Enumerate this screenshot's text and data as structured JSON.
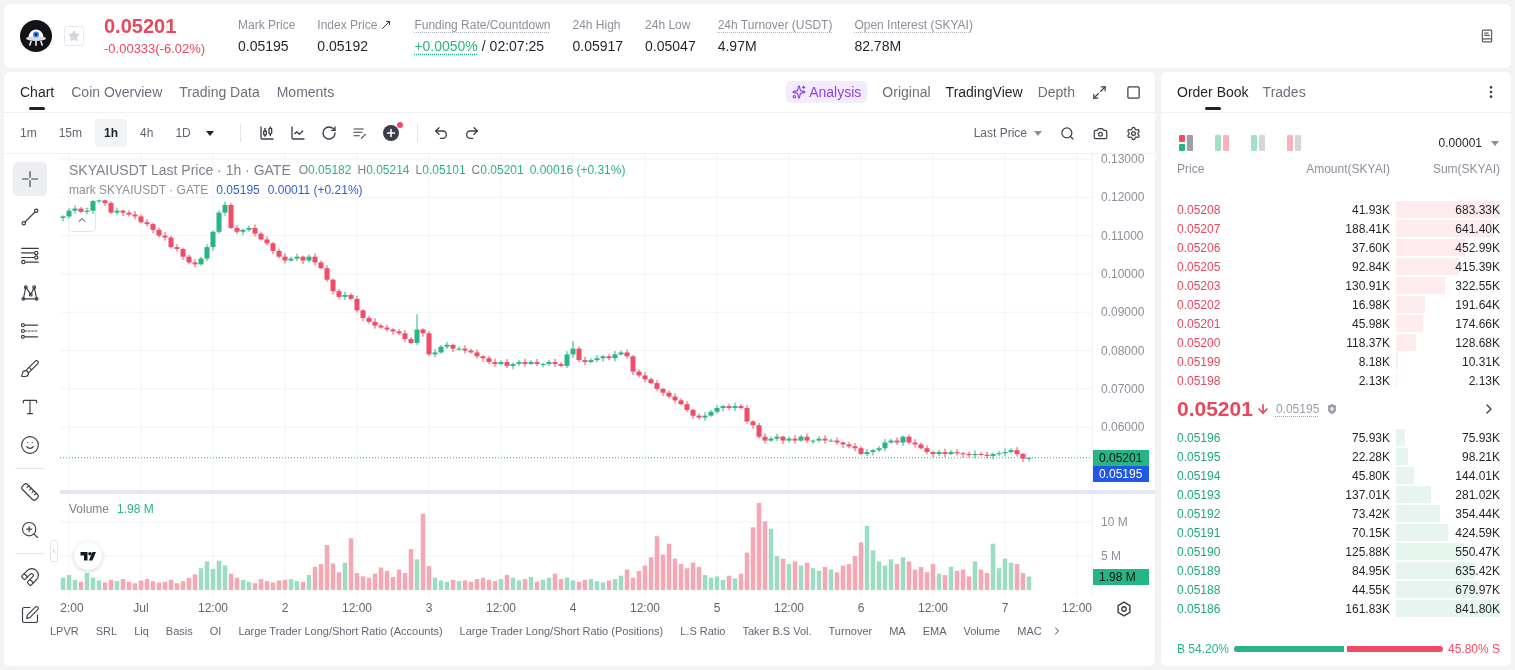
{
  "header": {
    "favorite": false,
    "last_price": "0.05201",
    "change": "-0.00333(-6.02%)",
    "rising": false,
    "stats": [
      {
        "label": "Mark Price",
        "value": "0.05195",
        "kind": "plain",
        "tooltip": false
      },
      {
        "label": "Index Price",
        "value": "0.05192",
        "kind": "link",
        "tooltip": false
      },
      {
        "label": "Funding Rate/Countdown",
        "value": "+0.0050%",
        "countdown": "/ 02:07:25",
        "kind": "funding",
        "tooltip": true
      },
      {
        "label": "24h High",
        "value": "0.05917",
        "kind": "plain",
        "tooltip": false
      },
      {
        "label": "24h Low",
        "value": "0.05047",
        "kind": "plain",
        "tooltip": false
      },
      {
        "label": "24h Turnover (USDT)",
        "value": "4.97M",
        "kind": "plain",
        "tooltip": true
      },
      {
        "label": "Open Interest (SKYAI)",
        "value": "82.78M",
        "kind": "plain",
        "tooltip": true
      }
    ]
  },
  "chart_panel": {
    "tabs": [
      {
        "label": "Chart",
        "selected": true
      },
      {
        "label": "Coin Overview",
        "selected": false
      },
      {
        "label": "Trading Data",
        "selected": false
      },
      {
        "label": "Moments",
        "selected": false
      }
    ],
    "views": [
      {
        "label": "Analysis",
        "kind": "ai",
        "selected": false
      },
      {
        "label": "Original",
        "kind": "plain",
        "selected": false
      },
      {
        "label": "TradingView",
        "kind": "plain",
        "selected": true
      },
      {
        "label": "Depth",
        "kind": "plain",
        "selected": false
      }
    ],
    "intervals": [
      {
        "label": "1m",
        "selected": false
      },
      {
        "label": "15m",
        "selected": false
      },
      {
        "label": "1h",
        "selected": true
      },
      {
        "label": "4h",
        "selected": false
      },
      {
        "label": "1D",
        "selected": false
      }
    ],
    "indicator_badge": true,
    "price_source": "Last Price",
    "tool_groups": [
      {
        "tools": [
          {
            "kind": "crosshair",
            "selected": true
          },
          {
            "kind": "trendline",
            "selected": false
          },
          {
            "kind": "hlines",
            "selected": false
          },
          {
            "kind": "pattern",
            "selected": false
          },
          {
            "kind": "fib",
            "selected": false
          },
          {
            "kind": "brush",
            "selected": false
          },
          {
            "kind": "text",
            "selected": false
          },
          {
            "kind": "emoji",
            "selected": false
          }
        ]
      },
      {
        "tools": [
          {
            "kind": "ruler",
            "selected": false
          },
          {
            "kind": "zoom",
            "selected": false
          }
        ]
      },
      {
        "tools": [
          {
            "kind": "magnet",
            "selected": false
          },
          {
            "kind": "lock",
            "selected": false
          }
        ]
      }
    ],
    "legend": {
      "title": "SKYAIUSDT Last Price · 1h · GATE",
      "rising": true,
      "ohlc": [
        {
          "key": "O",
          "value": "0.05182"
        },
        {
          "key": "H",
          "value": "0.05214"
        },
        {
          "key": "L",
          "value": "0.05101"
        },
        {
          "key": "C",
          "value": "0.05201"
        }
      ],
      "change": "0.00016 (+0.31%)"
    },
    "mark_legend": {
      "title": "mark SKYAIUSDT · GATE",
      "value": "0.05195",
      "change": "0.00011 (+0.21%)"
    },
    "price_chart": {
      "chart_data": {
        "type": "candlestick",
        "grid": true,
        "categories": [
          null,
          null,
          null,
          null,
          null,
          null,
          null,
          null,
          null,
          null,
          null,
          null,
          null,
          null,
          null,
          null,
          null,
          null,
          null,
          null,
          null,
          null,
          null,
          null,
          null,
          null,
          null,
          null,
          null,
          null,
          null,
          null,
          null,
          null,
          null,
          null,
          null,
          null,
          null,
          null,
          null,
          null,
          null,
          null,
          null,
          null,
          null,
          null,
          null,
          null,
          null,
          null,
          null,
          null,
          null,
          null,
          null,
          null,
          null,
          null,
          null,
          null,
          null,
          null,
          null,
          null,
          null,
          null,
          null,
          null,
          null,
          null,
          null,
          null,
          null,
          null,
          null,
          null,
          null,
          null,
          null,
          null,
          null,
          null,
          null,
          null,
          null,
          null,
          null,
          null,
          null,
          null,
          null,
          null,
          null,
          null,
          null,
          null,
          null,
          null,
          null,
          null,
          null,
          null,
          null,
          null,
          null,
          null,
          null,
          null,
          null,
          null,
          null,
          null,
          null,
          null,
          null,
          null,
          null,
          null,
          null,
          null,
          null,
          null,
          null,
          null,
          null,
          null,
          null,
          null,
          null,
          null,
          null,
          null,
          null,
          null,
          null,
          null,
          null,
          null,
          null,
          null,
          null,
          null,
          null,
          null,
          null,
          null,
          null,
          null,
          null,
          null,
          null,
          null,
          null,
          null,
          null,
          null,
          null,
          null,
          null,
          null,
          null,
          null,
          null,
          null,
          null,
          null,
          null,
          null,
          null,
          null
        ],
        "ylim": [
          0.0436,
          0.1313
        ],
        "yticks": [
          {
            "value": 0.13,
            "label": "0.13000"
          },
          {
            "value": 0.12,
            "label": "0.12000"
          },
          {
            "value": 0.11,
            "label": "0.11000"
          },
          {
            "value": 0.1,
            "label": "0.10000"
          },
          {
            "value": 0.09,
            "label": "0.09000"
          },
          {
            "value": 0.08,
            "label": "0.08000"
          },
          {
            "value": 0.07,
            "label": "0.07000"
          },
          {
            "value": 0.06,
            "label": "0.06000"
          }
        ],
        "ref_lines": [
          {
            "axis": "y",
            "value": 0.05201,
            "color": "#27b583"
          }
        ],
        "ohlc": [
          [
            0.1146,
            0.1153,
            0.1137,
            0.115
          ],
          [
            0.115,
            0.1171,
            0.1145,
            0.1165
          ],
          [
            0.1165,
            0.1179,
            0.1157,
            0.117
          ],
          [
            0.117,
            0.1175,
            0.1159,
            0.1162
          ],
          [
            0.1162,
            0.1173,
            0.1156,
            0.1165
          ],
          [
            0.1165,
            0.1193,
            0.1156,
            0.119
          ],
          [
            0.119,
            0.1194,
            0.1185,
            0.1192
          ],
          [
            0.1192,
            0.1194,
            0.1177,
            0.1185
          ],
          [
            0.1185,
            0.119,
            0.1157,
            0.116
          ],
          [
            0.116,
            0.1173,
            0.1154,
            0.1165
          ],
          [
            0.1165,
            0.1168,
            0.1151,
            0.116
          ],
          [
            0.116,
            0.1166,
            0.115,
            0.1155
          ],
          [
            0.1155,
            0.1164,
            0.1142,
            0.115
          ],
          [
            0.115,
            0.1155,
            0.1132,
            0.1135
          ],
          [
            0.1135,
            0.1143,
            0.1124,
            0.113
          ],
          [
            0.113,
            0.1133,
            0.1106,
            0.1115
          ],
          [
            0.1115,
            0.1121,
            0.1095,
            0.11
          ],
          [
            0.11,
            0.1109,
            0.1087,
            0.1095
          ],
          [
            0.1095,
            0.11,
            0.1067,
            0.107
          ],
          [
            0.107,
            0.1078,
            0.1059,
            0.1065
          ],
          [
            0.1065,
            0.1068,
            0.1036,
            0.1045
          ],
          [
            0.1045,
            0.1051,
            0.1025,
            0.103
          ],
          [
            0.103,
            0.1039,
            0.1017,
            0.1025
          ],
          [
            0.1025,
            0.1045,
            0.1022,
            0.104
          ],
          [
            0.104,
            0.1078,
            0.1034,
            0.107
          ],
          [
            0.107,
            0.1113,
            0.1061,
            0.111
          ],
          [
            0.111,
            0.1166,
            0.1105,
            0.116
          ],
          [
            0.116,
            0.1189,
            0.1152,
            0.118
          ],
          [
            0.118,
            0.1185,
            0.1117,
            0.112
          ],
          [
            0.112,
            0.1128,
            0.1104,
            0.111
          ],
          [
            0.111,
            0.1118,
            0.1101,
            0.1115
          ],
          [
            0.1115,
            0.1126,
            0.111,
            0.112
          ],
          [
            0.112,
            0.1129,
            0.1097,
            0.1105
          ],
          [
            0.1105,
            0.111,
            0.1087,
            0.109
          ],
          [
            0.109,
            0.1098,
            0.1074,
            0.108
          ],
          [
            0.108,
            0.1083,
            0.1051,
            0.106
          ],
          [
            0.106,
            0.1066,
            0.104,
            0.1045
          ],
          [
            0.1045,
            0.1054,
            0.1027,
            0.1035
          ],
          [
            0.1035,
            0.1045,
            0.1032,
            0.104
          ],
          [
            0.104,
            0.1053,
            0.1034,
            0.1045
          ],
          [
            0.1045,
            0.1048,
            0.1026,
            0.1035
          ],
          [
            0.1035,
            0.1051,
            0.103,
            0.1045
          ],
          [
            0.1045,
            0.1054,
            0.1022,
            0.103
          ],
          [
            0.103,
            0.1035,
            0.1012,
            0.1015
          ],
          [
            0.1015,
            0.1023,
            0.0979,
            0.0985
          ],
          [
            0.0985,
            0.0988,
            0.0946,
            0.0955
          ],
          [
            0.0955,
            0.0961,
            0.0935,
            0.094
          ],
          [
            0.094,
            0.0954,
            0.0932,
            0.0945
          ],
          [
            0.0945,
            0.095,
            0.0932,
            0.0935
          ],
          [
            0.0935,
            0.0943,
            0.0899,
            0.0905
          ],
          [
            0.0905,
            0.0908,
            0.0876,
            0.0885
          ],
          [
            0.0885,
            0.0891,
            0.087,
            0.0875
          ],
          [
            0.0875,
            0.0884,
            0.0857,
            0.0865
          ],
          [
            0.0865,
            0.087,
            0.0857,
            0.086
          ],
          [
            0.086,
            0.0868,
            0.0849,
            0.0855
          ],
          [
            0.0855,
            0.0858,
            0.0841,
            0.085
          ],
          [
            0.085,
            0.0856,
            0.084,
            0.0845
          ],
          [
            0.0845,
            0.0854,
            0.0822,
            0.083
          ],
          [
            0.083,
            0.0835,
            0.0817,
            0.082
          ],
          [
            0.082,
            0.0895,
            0.0814,
            0.0855
          ],
          [
            0.0855,
            0.0858,
            0.0836,
            0.0845
          ],
          [
            0.0845,
            0.0851,
            0.0785,
            0.079
          ],
          [
            0.079,
            0.0804,
            0.0782,
            0.0795
          ],
          [
            0.0795,
            0.0815,
            0.0792,
            0.081
          ],
          [
            0.081,
            0.0823,
            0.0804,
            0.0815
          ],
          [
            0.0815,
            0.0818,
            0.0796,
            0.0805
          ],
          [
            0.0805,
            0.0811,
            0.08,
            0.0805
          ],
          [
            0.0805,
            0.0814,
            0.0792,
            0.08
          ],
          [
            0.08,
            0.0805,
            0.0792,
            0.0795
          ],
          [
            0.0795,
            0.0803,
            0.0779,
            0.0785
          ],
          [
            0.0785,
            0.0788,
            0.0771,
            0.078
          ],
          [
            0.078,
            0.0786,
            0.0765,
            0.077
          ],
          [
            0.077,
            0.0779,
            0.0757,
            0.0765
          ],
          [
            0.0765,
            0.0775,
            0.0762,
            0.077
          ],
          [
            0.077,
            0.0778,
            0.0754,
            0.076
          ],
          [
            0.076,
            0.0768,
            0.0751,
            0.0765
          ],
          [
            0.0765,
            0.0776,
            0.076,
            0.077
          ],
          [
            0.077,
            0.0779,
            0.0757,
            0.0765
          ],
          [
            0.0765,
            0.0775,
            0.0762,
            0.077
          ],
          [
            0.077,
            0.0778,
            0.0759,
            0.0765
          ],
          [
            0.0765,
            0.0768,
            0.0756,
            0.0765
          ],
          [
            0.0765,
            0.0776,
            0.076,
            0.077
          ],
          [
            0.077,
            0.0779,
            0.0757,
            0.0765
          ],
          [
            0.0765,
            0.077,
            0.0757,
            0.076
          ],
          [
            0.076,
            0.0798,
            0.0754,
            0.079
          ],
          [
            0.079,
            0.0825,
            0.0781,
            0.0805
          ],
          [
            0.0805,
            0.0811,
            0.077,
            0.0775
          ],
          [
            0.0775,
            0.0784,
            0.0762,
            0.077
          ],
          [
            0.077,
            0.078,
            0.0767,
            0.0775
          ],
          [
            0.0775,
            0.0788,
            0.0769,
            0.078
          ],
          [
            0.078,
            0.0788,
            0.0771,
            0.0785
          ],
          [
            0.0785,
            0.0791,
            0.0775,
            0.078
          ],
          [
            0.078,
            0.0799,
            0.0772,
            0.079
          ],
          [
            0.079,
            0.08,
            0.0787,
            0.0795
          ],
          [
            0.0795,
            0.0803,
            0.0779,
            0.0785
          ],
          [
            0.0785,
            0.0788,
            0.0736,
            0.0745
          ],
          [
            0.0745,
            0.0751,
            0.073,
            0.0735
          ],
          [
            0.0735,
            0.0744,
            0.0717,
            0.0725
          ],
          [
            0.0725,
            0.073,
            0.0712,
            0.0715
          ],
          [
            0.0715,
            0.0723,
            0.0694,
            0.07
          ],
          [
            0.07,
            0.0703,
            0.0681,
            0.069
          ],
          [
            0.069,
            0.0696,
            0.0675,
            0.068
          ],
          [
            0.068,
            0.0689,
            0.0662,
            0.067
          ],
          [
            0.067,
            0.0675,
            0.0657,
            0.066
          ],
          [
            0.066,
            0.0668,
            0.0639,
            0.0645
          ],
          [
            0.0645,
            0.0648,
            0.0621,
            0.063
          ],
          [
            0.063,
            0.0636,
            0.062,
            0.0625
          ],
          [
            0.0625,
            0.0639,
            0.0617,
            0.063
          ],
          [
            0.063,
            0.0645,
            0.0627,
            0.064
          ],
          [
            0.064,
            0.0658,
            0.0634,
            0.065
          ],
          [
            0.065,
            0.0658,
            0.0641,
            0.0655
          ],
          [
            0.0655,
            0.0661,
            0.0645,
            0.065
          ],
          [
            0.065,
            0.0664,
            0.0642,
            0.0655
          ],
          [
            0.0655,
            0.066,
            0.0647,
            0.065
          ],
          [
            0.065,
            0.0658,
            0.0609,
            0.0615
          ],
          [
            0.0615,
            0.0618,
            0.0596,
            0.0605
          ],
          [
            0.0605,
            0.0611,
            0.057,
            0.0575
          ],
          [
            0.0575,
            0.0584,
            0.0557,
            0.0565
          ],
          [
            0.0565,
            0.0575,
            0.0562,
            0.057
          ],
          [
            0.057,
            0.0583,
            0.0564,
            0.0575
          ],
          [
            0.0575,
            0.0578,
            0.0556,
            0.0565
          ],
          [
            0.0565,
            0.0576,
            0.056,
            0.057
          ],
          [
            0.057,
            0.0579,
            0.0557,
            0.0565
          ],
          [
            0.0565,
            0.058,
            0.0562,
            0.0575
          ],
          [
            0.0575,
            0.0583,
            0.0559,
            0.0565
          ],
          [
            0.0565,
            0.0568,
            0.0556,
            0.0565
          ],
          [
            0.0565,
            0.0576,
            0.056,
            0.057
          ],
          [
            0.057,
            0.0579,
            0.0557,
            0.0565
          ],
          [
            0.0565,
            0.057,
            0.0562,
            0.0565
          ],
          [
            0.0565,
            0.0573,
            0.0554,
            0.056
          ],
          [
            0.056,
            0.0563,
            0.0546,
            0.0555
          ],
          [
            0.0555,
            0.0561,
            0.0545,
            0.055
          ],
          [
            0.055,
            0.0559,
            0.0537,
            0.0545
          ],
          [
            0.0545,
            0.055,
            0.0527,
            0.053
          ],
          [
            0.053,
            0.0543,
            0.0524,
            0.0535
          ],
          [
            0.0535,
            0.0543,
            0.0526,
            0.054
          ],
          [
            0.054,
            0.0551,
            0.0535,
            0.0545
          ],
          [
            0.0545,
            0.0569,
            0.0537,
            0.056
          ],
          [
            0.056,
            0.057,
            0.0557,
            0.0565
          ],
          [
            0.0565,
            0.0573,
            0.0554,
            0.056
          ],
          [
            0.056,
            0.0578,
            0.0551,
            0.0575
          ],
          [
            0.0575,
            0.0581,
            0.0555,
            0.056
          ],
          [
            0.056,
            0.0569,
            0.0547,
            0.0555
          ],
          [
            0.0555,
            0.056,
            0.0542,
            0.0545
          ],
          [
            0.0545,
            0.0553,
            0.0529,
            0.0535
          ],
          [
            0.0535,
            0.0538,
            0.0521,
            0.053
          ],
          [
            0.053,
            0.0541,
            0.0525,
            0.0535
          ],
          [
            0.0535,
            0.0544,
            0.0522,
            0.053
          ],
          [
            0.053,
            0.054,
            0.0527,
            0.0535
          ],
          [
            0.0535,
            0.0543,
            0.0526,
            0.0532
          ],
          [
            0.0532,
            0.0535,
            0.0521,
            0.053
          ],
          [
            0.053,
            0.0536,
            0.0522,
            0.0527
          ],
          [
            0.0527,
            0.0539,
            0.0519,
            0.053
          ],
          [
            0.053,
            0.0535,
            0.0525,
            0.0528
          ],
          [
            0.0528,
            0.0536,
            0.0519,
            0.0525
          ],
          [
            0.0525,
            0.0533,
            0.0516,
            0.053
          ],
          [
            0.053,
            0.0538,
            0.0525,
            0.0532
          ],
          [
            0.0532,
            0.0544,
            0.0524,
            0.0535
          ],
          [
            0.0535,
            0.0545,
            0.0532,
            0.054
          ],
          [
            0.054,
            0.0548,
            0.0524,
            0.053
          ],
          [
            0.053,
            0.0533,
            0.0509,
            0.0518
          ],
          [
            0.05182,
            0.05214,
            0.05101,
            0.05201
          ],
          null,
          null,
          null,
          null,
          null,
          null,
          null,
          null,
          null,
          null
        ]
      }
    },
    "price_tags": [
      {
        "label": "0.05201",
        "kind": "last",
        "color": "#27b583"
      },
      {
        "label": "0.05195",
        "kind": "mark",
        "color": "#1f57e6"
      }
    ],
    "volume": {
      "value": "1.98 M",
      "tag": "1.98 M",
      "chart_data": {
        "type": "bar",
        "grid": true,
        "categories": [
          null,
          "2:00",
          null,
          null,
          null,
          null,
          null,
          null,
          null,
          null,
          null,
          null,
          null,
          "Jul",
          null,
          null,
          null,
          null,
          null,
          null,
          null,
          null,
          null,
          null,
          null,
          "12:00",
          null,
          null,
          null,
          null,
          null,
          null,
          null,
          null,
          null,
          null,
          null,
          "2",
          null,
          null,
          null,
          null,
          null,
          null,
          null,
          null,
          null,
          null,
          null,
          "12:00",
          null,
          null,
          null,
          null,
          null,
          null,
          null,
          null,
          null,
          null,
          null,
          "3",
          null,
          null,
          null,
          null,
          null,
          null,
          null,
          null,
          null,
          null,
          null,
          "12:00",
          null,
          null,
          null,
          null,
          null,
          null,
          null,
          null,
          null,
          null,
          null,
          "4",
          null,
          null,
          null,
          null,
          null,
          null,
          null,
          null,
          null,
          null,
          null,
          "12:00",
          null,
          null,
          null,
          null,
          null,
          null,
          null,
          null,
          null,
          null,
          null,
          "5",
          null,
          null,
          null,
          null,
          null,
          null,
          null,
          null,
          null,
          null,
          null,
          "12:00",
          null,
          null,
          null,
          null,
          null,
          null,
          null,
          null,
          null,
          null,
          null,
          "6",
          null,
          null,
          null,
          null,
          null,
          null,
          null,
          null,
          null,
          null,
          null,
          "12:00",
          null,
          null,
          null,
          null,
          null,
          null,
          null,
          null,
          null,
          null,
          null,
          "7",
          null,
          null,
          null,
          null,
          null,
          null,
          null,
          null,
          null,
          null,
          null,
          "12:00",
          null,
          null
        ],
        "ylim": [
          0,
          14.1
        ],
        "yticks": [
          {
            "value": 5,
            "label": "5 M"
          },
          {
            "value": 10,
            "label": "10 M"
          }
        ],
        "series": [
          {
            "name": "Volume",
            "values": [
              1.8,
              2.2,
              1.5,
              1.2,
              2.5,
              1.8,
              1.4,
              1.1,
              1.5,
              1.3,
              1.6,
              1.2,
              1.0,
              1.4,
              1.6,
              1.3,
              1.1,
              1.2,
              1.5,
              1.0,
              1.3,
              1.8,
              2.3,
              3.2,
              4.2,
              3.1,
              4.3,
              3.6,
              2.4,
              1.8,
              1.5,
              1.2,
              1.0,
              1.6,
              1.3,
              1.1,
              1.4,
              1.5,
              1.6,
              1.3,
              1.2,
              2.2,
              3.4,
              3.8,
              6.6,
              3.9,
              2.6,
              4.0,
              7.6,
              2.5,
              2.0,
              1.8,
              2.4,
              3.3,
              2.8,
              1.9,
              3.0,
              2.5,
              6.0,
              4.5,
              11.2,
              3.5,
              1.8,
              1.4,
              1.2,
              1.5,
              1.3,
              1.4,
              1.2,
              1.6,
              1.8,
              1.5,
              1.3,
              1.6,
              2.2,
              1.8,
              1.4,
              1.6,
              1.9,
              1.2,
              1.5,
              1.8,
              2.4,
              1.6,
              1.8,
              1.4,
              1.2,
              1.5,
              1.6,
              1.3,
              1.1,
              1.4,
              1.6,
              2.1,
              3.0,
              1.8,
              2.8,
              3.6,
              4.8,
              7.9,
              5.2,
              6.8,
              4.6,
              3.8,
              3.2,
              4.0,
              3.4,
              2.2,
              1.8,
              2.0,
              1.5,
              2.1,
              1.7,
              2.4,
              5.5,
              9.2,
              12.8,
              10.1,
              9.0,
              5.0,
              4.6,
              3.8,
              4.2,
              3.6,
              4.0,
              3.2,
              2.8,
              3.4,
              3.0,
              2.6,
              3.6,
              3.8,
              5.0,
              7.0,
              9.4,
              5.8,
              4.2,
              3.6,
              4.5,
              3.8,
              4.8,
              4.2,
              3.0,
              3.4,
              2.6,
              3.8,
              2.4,
              2.2,
              3.4,
              2.8,
              3.0,
              2.0,
              4.2,
              3.0,
              2.5,
              6.8,
              3.2,
              4.6,
              4.0,
              3.8,
              2.5,
              1.98,
              null,
              null,
              null,
              null,
              null,
              null,
              null,
              null,
              null,
              null
            ]
          }
        ]
      }
    },
    "indicators": [
      "LPVR",
      "SRL",
      "Liq",
      "Basis",
      "OI",
      "Large Trader Long/Short Ratio (Accounts)",
      "Large Trader Long/Short Ratio (Positions)",
      "L.S Ratio",
      "Taker B.S Vol.",
      "Turnover",
      "MA",
      "EMA",
      "Volume",
      "MAC"
    ]
  },
  "order_book": {
    "tabs": [
      {
        "label": "Order Book",
        "selected": true
      },
      {
        "label": "Trades",
        "selected": false
      }
    ],
    "views": [
      {
        "kind": "stacked",
        "selected": true
      },
      {
        "kind": "split",
        "selected": false
      },
      {
        "kind": "bids",
        "selected": false
      },
      {
        "kind": "asks",
        "selected": false
      }
    ],
    "precision": "0.00001",
    "columns": [
      "Price",
      "Amount(SKYAI)",
      "Sum(SKYAI)"
    ],
    "asks": [
      {
        "price": "0.05208",
        "amount": "41.93K",
        "sum": "683.33K"
      },
      {
        "price": "0.05207",
        "amount": "188.41K",
        "sum": "641.40K"
      },
      {
        "price": "0.05206",
        "amount": "37.60K",
        "sum": "452.99K"
      },
      {
        "price": "0.05205",
        "amount": "92.84K",
        "sum": "415.39K"
      },
      {
        "price": "0.05203",
        "amount": "130.91K",
        "sum": "322.55K"
      },
      {
        "price": "0.05202",
        "amount": "16.98K",
        "sum": "191.64K"
      },
      {
        "price": "0.05201",
        "amount": "45.98K",
        "sum": "174.66K"
      },
      {
        "price": "0.05200",
        "amount": "118.37K",
        "sum": "128.68K"
      },
      {
        "price": "0.05199",
        "amount": "8.18K",
        "sum": "10.31K"
      },
      {
        "price": "0.05198",
        "amount": "2.13K",
        "sum": "2.13K"
      }
    ],
    "last_price": "0.05201",
    "rising": false,
    "mark_price": "0.05195",
    "bids": [
      {
        "price": "0.05196",
        "amount": "75.93K",
        "sum": "75.93K"
      },
      {
        "price": "0.05195",
        "amount": "22.28K",
        "sum": "98.21K"
      },
      {
        "price": "0.05194",
        "amount": "45.80K",
        "sum": "144.01K"
      },
      {
        "price": "0.05193",
        "amount": "137.01K",
        "sum": "281.02K"
      },
      {
        "price": "0.05192",
        "amount": "73.42K",
        "sum": "354.44K"
      },
      {
        "price": "0.05191",
        "amount": "70.15K",
        "sum": "424.59K"
      },
      {
        "price": "0.05190",
        "amount": "125.88K",
        "sum": "550.47K"
      },
      {
        "price": "0.05189",
        "amount": "84.95K",
        "sum": "635.42K"
      },
      {
        "price": "0.05188",
        "amount": "44.55K",
        "sum": "679.97K"
      },
      {
        "price": "0.05186",
        "amount": "161.83K",
        "sum": "841.80K"
      }
    ],
    "ratio": {
      "buy": "B 54.20%",
      "sell": "45.80% S",
      "level": 0.542
    }
  }
}
